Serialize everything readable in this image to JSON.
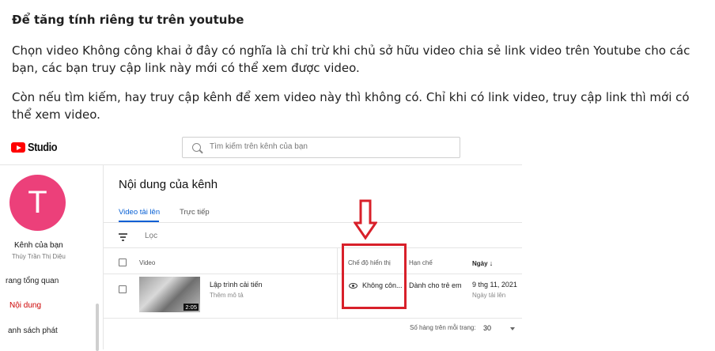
{
  "article": {
    "title": "Để tăng tính riêng tư trên youtube",
    "paragraph1": "Chọn video Không công khai ở đây có nghĩa là chỉ trừ khi chủ sở hữu video chia sẻ link video trên Youtube cho các bạn, các bạn truy cập link này mới có thể xem được video.",
    "paragraph2": "Còn nếu tìm kiếm, hay truy cập kênh để xem video này thì không có. Chỉ khi có link video, truy cập link thì mới có thể xem video."
  },
  "studio": {
    "logo_text": "Studio",
    "search_placeholder": "Tìm kiếm trên kênh của bạn",
    "sidebar": {
      "avatar_letter": "T",
      "channel_name": "Kênh của bạn",
      "channel_owner": "Thúy Trần Thị Diệu",
      "items": [
        {
          "label": "rang tổng quan"
        },
        {
          "label": "Nội dung"
        },
        {
          "label": "anh sách phát"
        }
      ]
    },
    "main": {
      "page_title": "Nội dung của kênh",
      "tabs": [
        {
          "label": "Video tải lên"
        },
        {
          "label": "Trực tiếp"
        }
      ],
      "filter_label": "Lọc",
      "columns": {
        "video": "Video",
        "visibility": "Chế độ hiển thị",
        "restrictions": "Hạn chế",
        "date": "Ngày"
      },
      "rows": [
        {
          "title": "Lập trình cải tiến",
          "description": "Thêm mô tả",
          "duration": "2:05",
          "visibility": "Không côn...",
          "restriction": "Dành cho trẻ em",
          "date": "9 thg 11, 2021",
          "date_sub": "Ngày tải lên"
        }
      ],
      "rows_per_page_label": "Số hàng trên mỗi trang:",
      "rows_per_page_value": "30"
    },
    "colors": {
      "brand_red": "#ff0000",
      "avatar": "#ec407a",
      "tab_active": "#065fd4",
      "highlight": "#d8202a"
    }
  }
}
